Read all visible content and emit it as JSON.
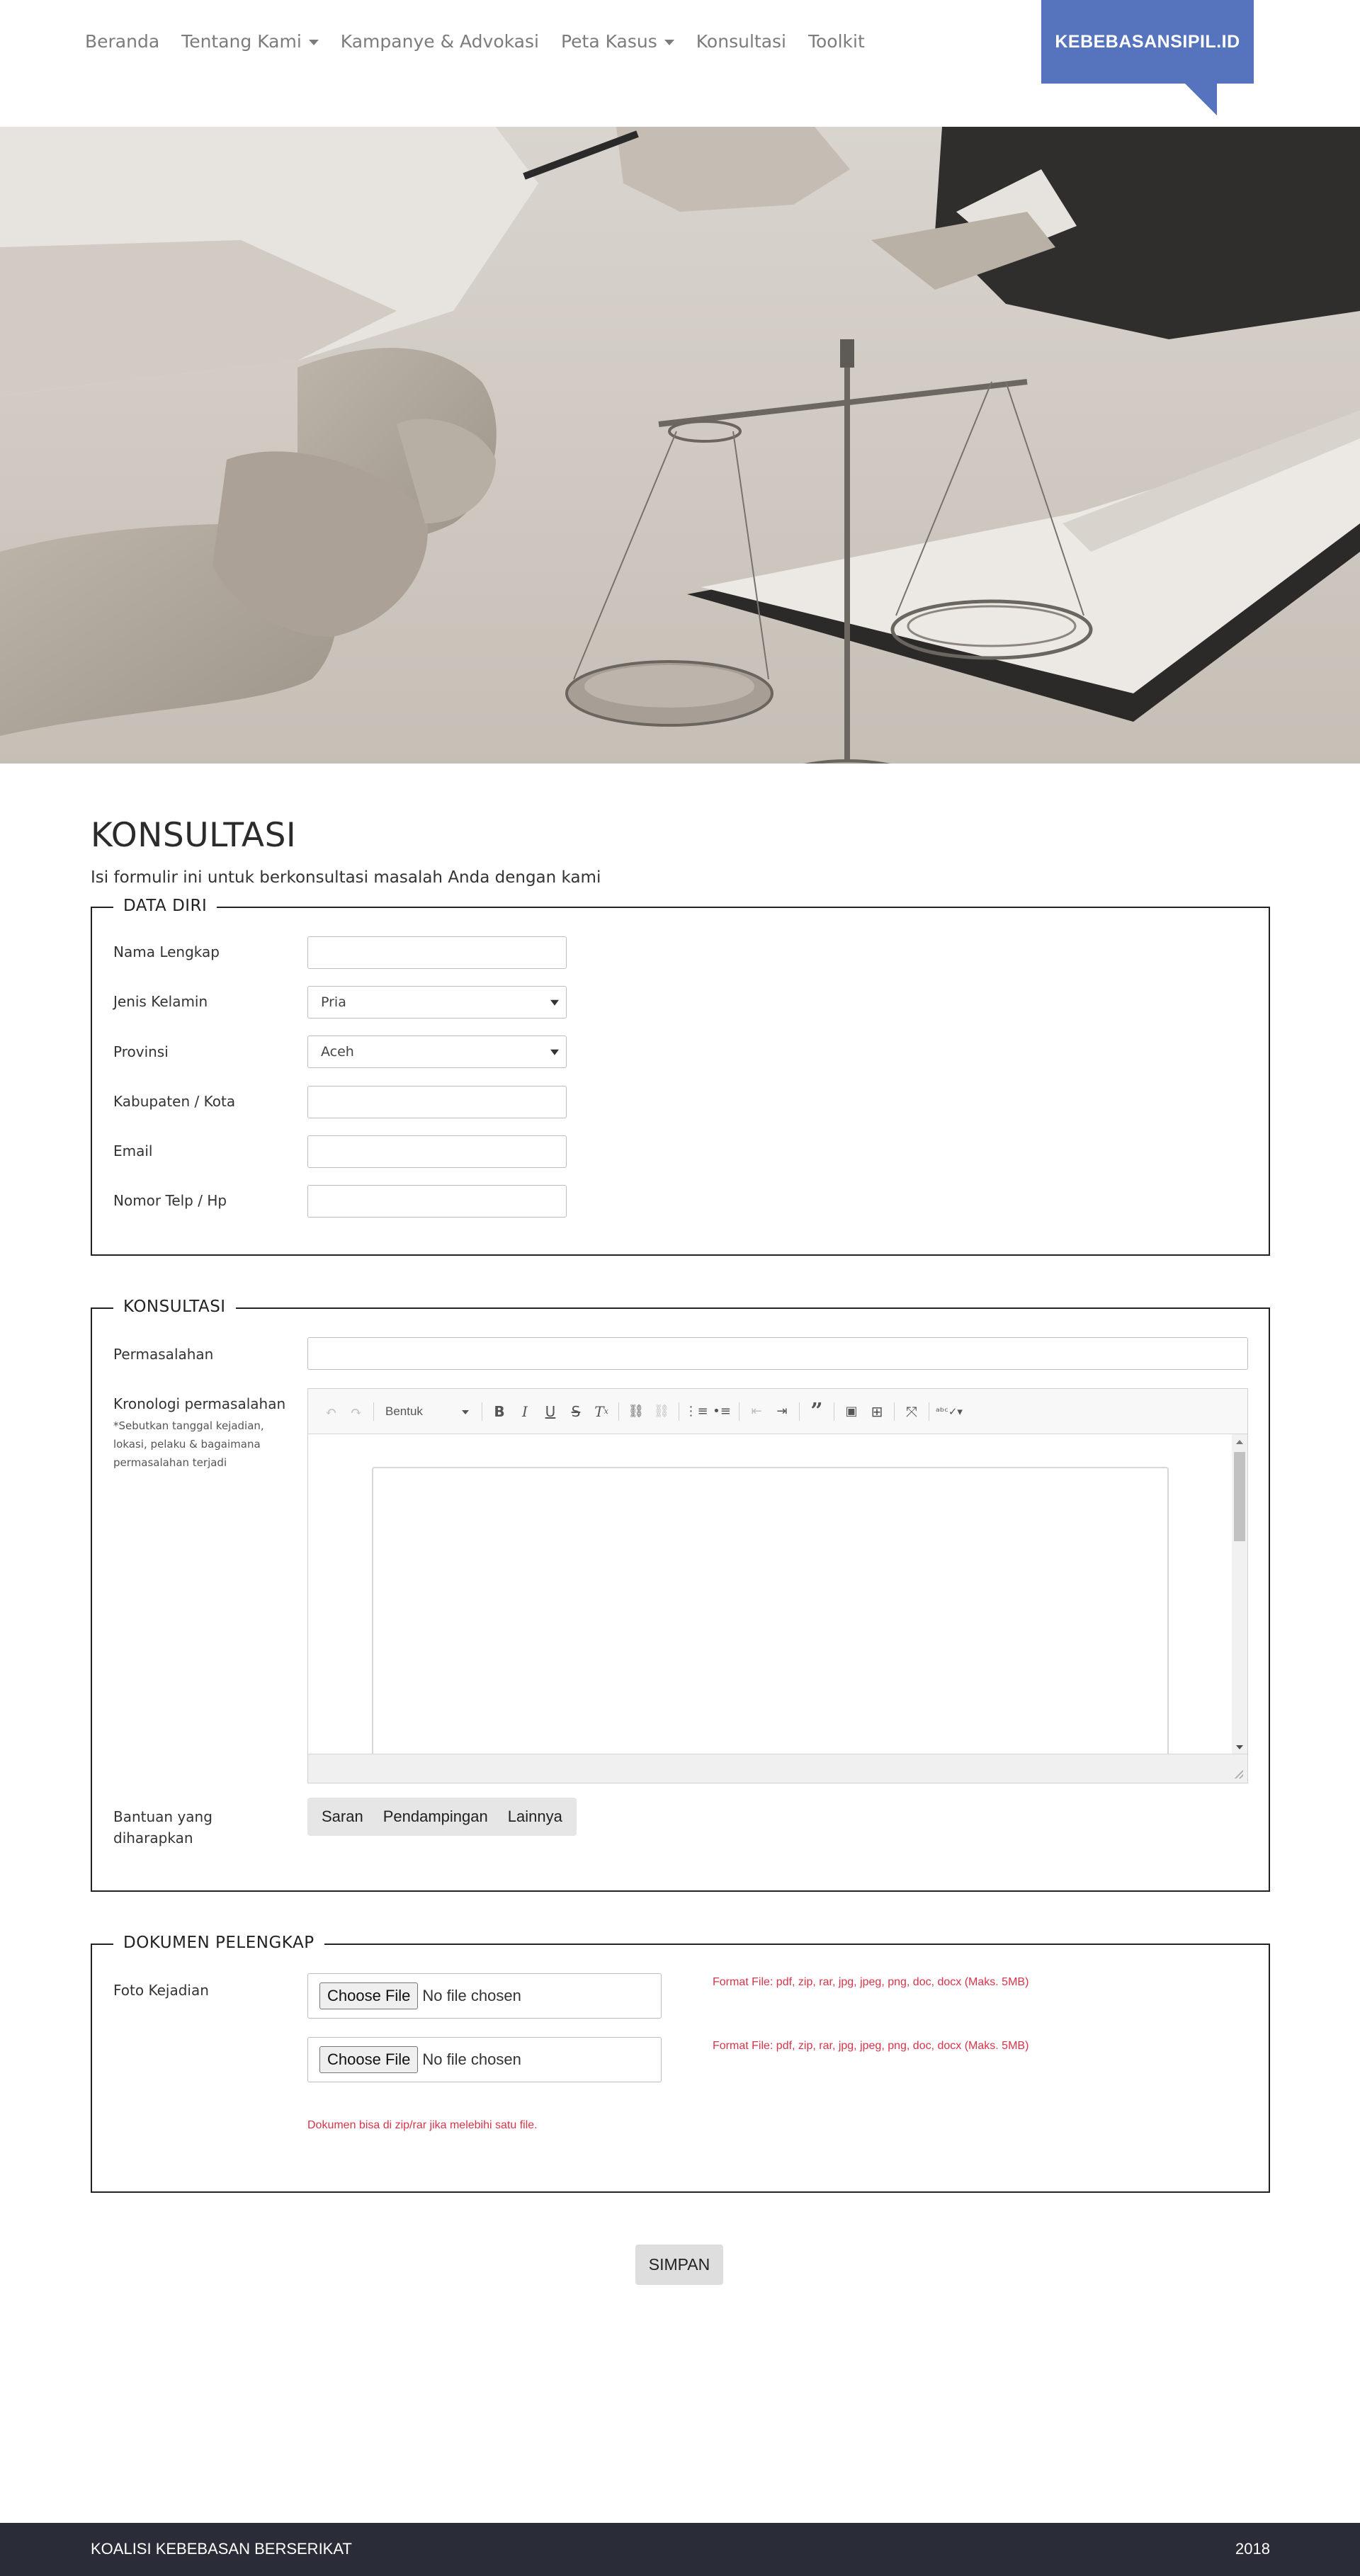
{
  "nav": {
    "items": [
      {
        "label": "Beranda",
        "dropdown": false
      },
      {
        "label": "Tentang Kami",
        "dropdown": true
      },
      {
        "label": "Kampanye & Advokasi",
        "dropdown": false
      },
      {
        "label": "Peta Kasus",
        "dropdown": true
      },
      {
        "label": "Konsultasi",
        "dropdown": false
      },
      {
        "label": "Toolkit",
        "dropdown": false
      }
    ],
    "brand": "KEBEBASANSIPIL.ID",
    "brand_color": "#5673be"
  },
  "page": {
    "title": "KONSULTASI",
    "subtitle": "Isi formulir ini untuk berkonsultasi masalah Anda dengan kami"
  },
  "data_diri": {
    "legend": "DATA DIRI",
    "nama_label": "Nama Lengkap",
    "gender_label": "Jenis Kelamin",
    "gender_value": "Pria",
    "provinsi_label": "Provinsi",
    "provinsi_value": "Aceh",
    "kota_label": "Kabupaten / Kota",
    "email_label": "Email",
    "telp_label": "Nomor Telp / Hp"
  },
  "konsultasi": {
    "legend": "KONSULTASI",
    "permasalahan_label": "Permasalahan",
    "kronologi_label": "Kronologi permasalahan",
    "kronologi_note": "*Sebutkan tanggal kejadian, lokasi, pelaku & bagaimana permasalahan terjadi",
    "format_label": "Bentuk",
    "bantuan_label": "Bantuan yang diharapkan",
    "bantuan_options": [
      "Saran",
      "Pendampingan",
      "Lainnya"
    ]
  },
  "dokumen": {
    "legend": "DOKUMEN PELENGKAP",
    "foto_label": "Foto Kejadian",
    "choose_file": "Choose File",
    "no_file": "No file chosen",
    "format_note": "Format File: pdf, zip, rar, jpg, jpeg, png, doc, docx (Maks. 5MB)",
    "zip_note": "Dokumen bisa di zip/rar jika melebihi satu file."
  },
  "submit_label": "SIMPAN",
  "footer": {
    "left": "KOALISI KEBEBASAN BERSERIKAT",
    "right": "2018",
    "bg_color": "#2a2d38"
  },
  "colors": {
    "note_red": "#d9334a"
  }
}
